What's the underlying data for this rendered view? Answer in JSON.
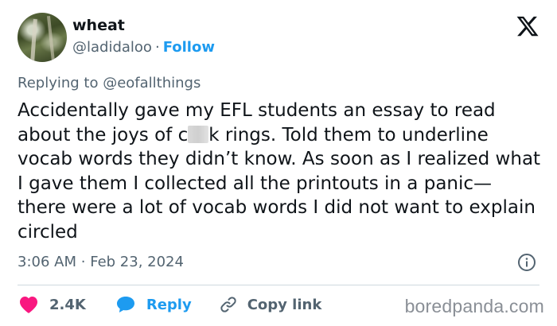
{
  "author": {
    "display_name": "wheat",
    "handle": "@ladidaloo",
    "separator": "·",
    "follow_label": "Follow"
  },
  "reply_context": {
    "prefix": "Replying to",
    "handle": "@eofallthings"
  },
  "tweet": {
    "text_before_censor": "Accidentally gave my EFL students an essay to read about the joys of c",
    "text_after_censor": "k rings. Told them to underline vocab words they didn’t know. As soon as I realized what I gave them I collected all the printouts in a panic— there were a lot of vocab words I did not want to explain circled",
    "time": "3:06 AM",
    "separator": "·",
    "date": "Feb 23, 2024"
  },
  "actions": {
    "like_count": "2.4K",
    "reply_label": "Reply",
    "copy_link_label": "Copy link"
  },
  "watermark": "boredpanda.com",
  "colors": {
    "accent": "#1d9bf0",
    "like": "#f91880",
    "text": "#0f1419",
    "muted": "#536471",
    "divider": "#cfd9de"
  },
  "icons": {
    "brand": "x-logo-icon",
    "info": "info-icon",
    "like": "heart-icon",
    "reply": "speech-bubble-icon",
    "copy": "link-icon"
  }
}
